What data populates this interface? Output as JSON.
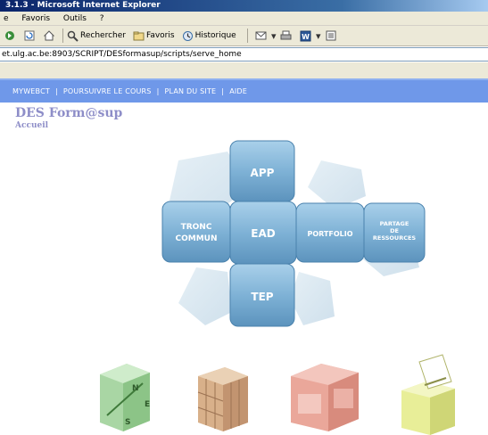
{
  "window": {
    "title": "3.1.3 - Microsoft Internet Explorer"
  },
  "menu": {
    "items": [
      "e",
      "Favoris",
      "Outils",
      "?"
    ]
  },
  "toolbar": {
    "search_label": "Rechercher",
    "favorites_label": "Favoris",
    "history_label": "Historique"
  },
  "address": {
    "url": "et.ulg.ac.be:8903/SCRIPT/DESformasup/scripts/serve_home"
  },
  "nav": {
    "items": [
      "MYWEBCT",
      "POURSUIVRE LE COURS",
      "PLAN DU SITE",
      "AIDE"
    ]
  },
  "site": {
    "title": "DES Form@sup",
    "subtitle": "Accueil"
  },
  "puzzle": {
    "app": "APP",
    "tronc_line1": "TRONC",
    "tronc_line2": "COMMUN",
    "ead": "EAD",
    "portfolio": "PORTFOLIO",
    "partage_line1": "PARTAGE",
    "partage_line2": "DE",
    "partage_line3": "RESSOURCES",
    "tep": "TEP"
  },
  "compass": {
    "n": "N",
    "e": "E",
    "s": "S"
  },
  "colors": {
    "nav_bg": "#6f98e9",
    "title_color": "#8e8ec8",
    "tile_blue": "#7fb2d6"
  }
}
